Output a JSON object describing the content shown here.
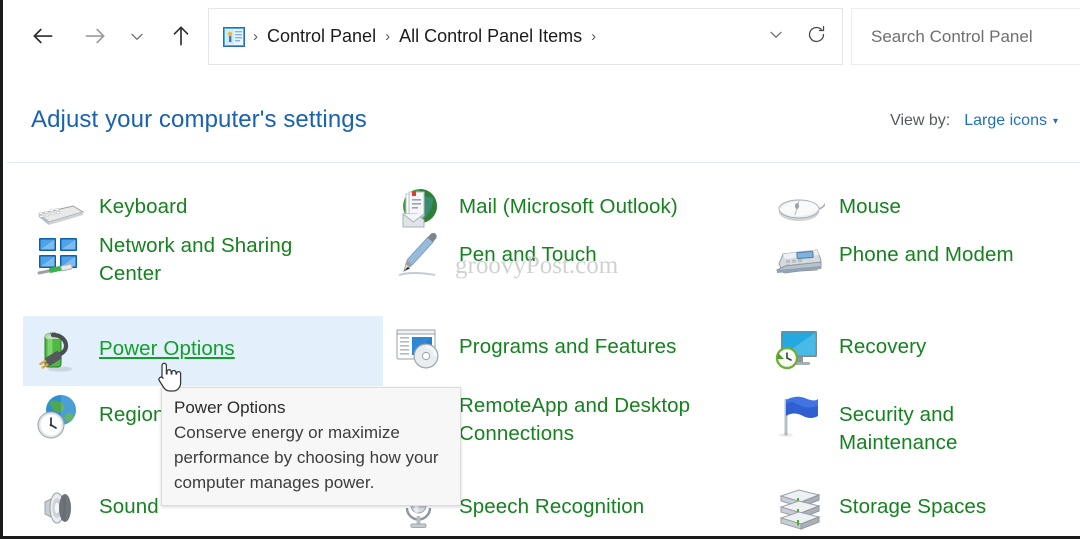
{
  "window": {
    "title": "Control Panel - All Control Panel Items"
  },
  "toolbar": {
    "back_icon": "back-arrow-icon",
    "forward_icon": "forward-arrow-icon",
    "recent_icon": "chevron-down-icon",
    "up_icon": "up-arrow-icon",
    "address_icon": "control-panel-icon",
    "breadcrumbs": [
      "Control Panel",
      "All Control Panel Items"
    ],
    "separator": "›",
    "history_dropdown_icon": "chevron-down-icon",
    "refresh_icon": "refresh-icon",
    "refresh_label": "Refresh"
  },
  "search": {
    "placeholder": "Search Control Panel",
    "value": ""
  },
  "header": {
    "title": "Adjust your computer's settings",
    "view_by_label": "View by:",
    "view_by_value": "Large icons",
    "view_by_caret": "▾"
  },
  "items": [
    {
      "label": "Keyboard",
      "icon": "keyboard-icon",
      "col": 0,
      "row": 0,
      "hovered": false
    },
    {
      "label": "Mail (Microsoft Outlook)",
      "icon": "mail-icon",
      "col": 1,
      "row": 0,
      "hovered": false
    },
    {
      "label": "Mouse",
      "icon": "mouse-icon",
      "col": 2,
      "row": 0,
      "hovered": false
    },
    {
      "label": "Network and Sharing\nCenter",
      "icon": "network-sharing-icon",
      "col": 0,
      "row": 1,
      "hovered": false
    },
    {
      "label": "Pen and Touch",
      "icon": "pen-touch-icon",
      "col": 1,
      "row": 1,
      "hovered": false
    },
    {
      "label": "Phone and Modem",
      "icon": "phone-modem-icon",
      "col": 2,
      "row": 1,
      "hovered": false
    },
    {
      "label": "Power Options",
      "icon": "power-options-icon",
      "col": 0,
      "row": 2,
      "hovered": true
    },
    {
      "label": "Programs and Features",
      "icon": "programs-features-icon",
      "col": 1,
      "row": 2,
      "hovered": false
    },
    {
      "label": "Recovery",
      "icon": "recovery-icon",
      "col": 2,
      "row": 2,
      "hovered": false
    },
    {
      "label": "Region",
      "icon": "region-icon",
      "col": 0,
      "row": 3,
      "hovered": false
    },
    {
      "label": "RemoteApp and Desktop\nConnections",
      "icon": "remoteapp-icon",
      "col": 1,
      "row": 3,
      "hovered": false
    },
    {
      "label": "Security and Maintenance",
      "icon": "security-maintenance-icon",
      "col": 2,
      "row": 3,
      "hovered": false
    },
    {
      "label": "Sound",
      "icon": "sound-icon",
      "col": 0,
      "row": 4,
      "hovered": false
    },
    {
      "label": "Speech Recognition",
      "icon": "speech-recognition-icon",
      "col": 1,
      "row": 4,
      "hovered": false
    },
    {
      "label": "Storage Spaces",
      "icon": "storage-spaces-icon",
      "col": 2,
      "row": 4,
      "hovered": false
    }
  ],
  "tooltip": {
    "title": "Power Options",
    "body": "Conserve energy or maximize performance by choosing how your computer manages power."
  },
  "watermark": {
    "text": "groovyPost.com"
  },
  "colors": {
    "link_green": "#15821f",
    "hover_green": "#11a02a",
    "title_blue": "#1962b0",
    "accent_blue": "#1f6fc4",
    "hover_bg": "#e3effb",
    "divider": "#e2eaf6"
  }
}
